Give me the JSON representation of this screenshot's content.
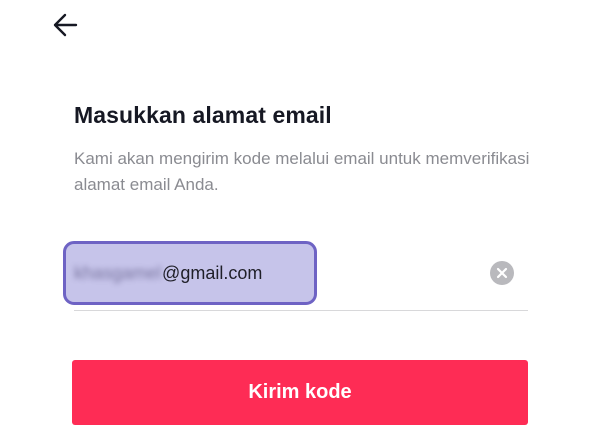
{
  "nav": {
    "back_icon": "arrow-left-icon"
  },
  "content": {
    "title": "Masukkan alamat email",
    "description": "Kami akan mengirim kode melalui email untuk memverifikasi alamat email Anda."
  },
  "email_input": {
    "value_masked": "khasgamel",
    "value_domain": "@gmail.com",
    "clear_icon": "clear-circle-icon"
  },
  "actions": {
    "send_code_label": "Kirim kode"
  },
  "colors": {
    "primary_button": "#fe2c55",
    "title_text": "#161823",
    "secondary_text": "#8a8b91",
    "highlight_fill": "#c6c4ea",
    "highlight_border": "#6e63c4",
    "clear_icon_bg": "#b9b9bd"
  }
}
